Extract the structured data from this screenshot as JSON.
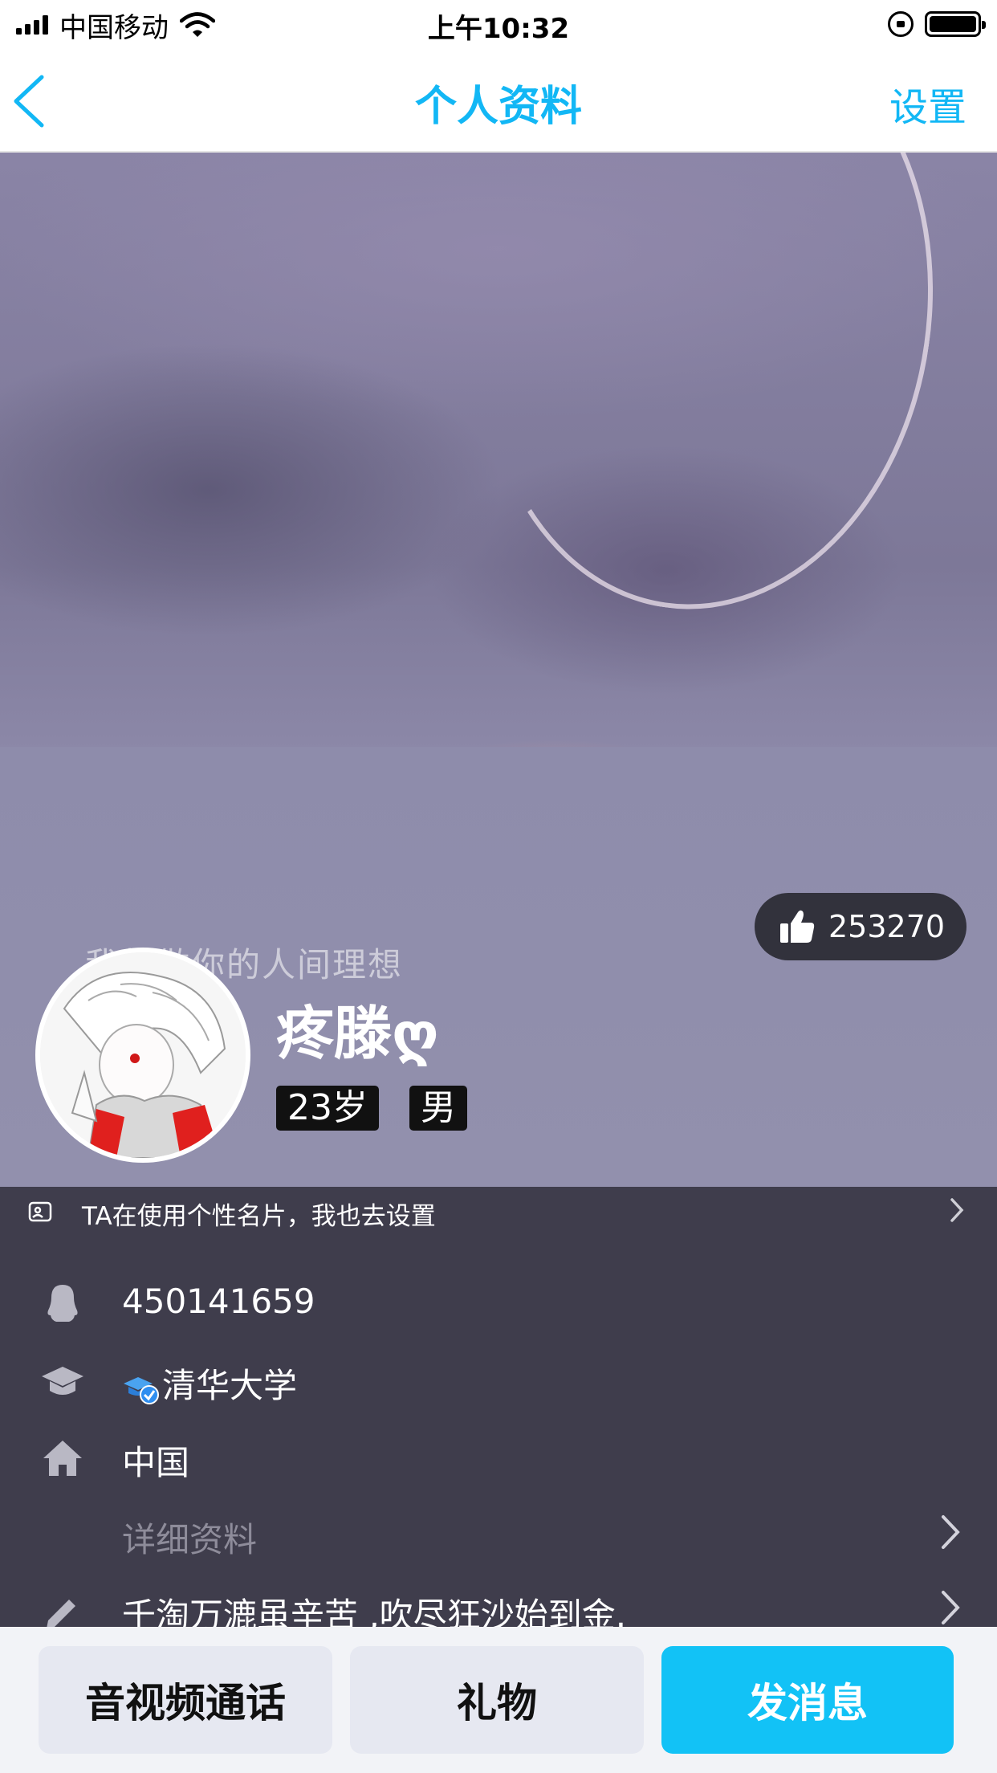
{
  "status_bar": {
    "carrier": "中国移动",
    "time": "上午10:32",
    "icons": [
      "signal-icon",
      "wifi-icon",
      "rotation-lock-icon",
      "battery-icon"
    ]
  },
  "nav": {
    "back_icon": "chevron-left-icon",
    "title": "个人资料",
    "settings_label": "设置",
    "accent_color": "#12b7f5"
  },
  "profile": {
    "cover_caption": "我想做你的人间理想",
    "like_count": "253270",
    "nickname": "疼滕ღ",
    "age_tag": "23岁",
    "gender_tag": "男"
  },
  "info": {
    "card_tip": "TA在使用个性名片，我也去设置",
    "qq_number": "450141659",
    "school": "清华大学",
    "hometown": "中国",
    "detail_label": "详细资料",
    "signature": "千淘万漉虽辛苦 ,吹尽狂沙始到金."
  },
  "actions": {
    "call_label": "音视频通话",
    "gift_label": "礼物",
    "message_label": "发消息",
    "message_color": "#12c2f6"
  }
}
